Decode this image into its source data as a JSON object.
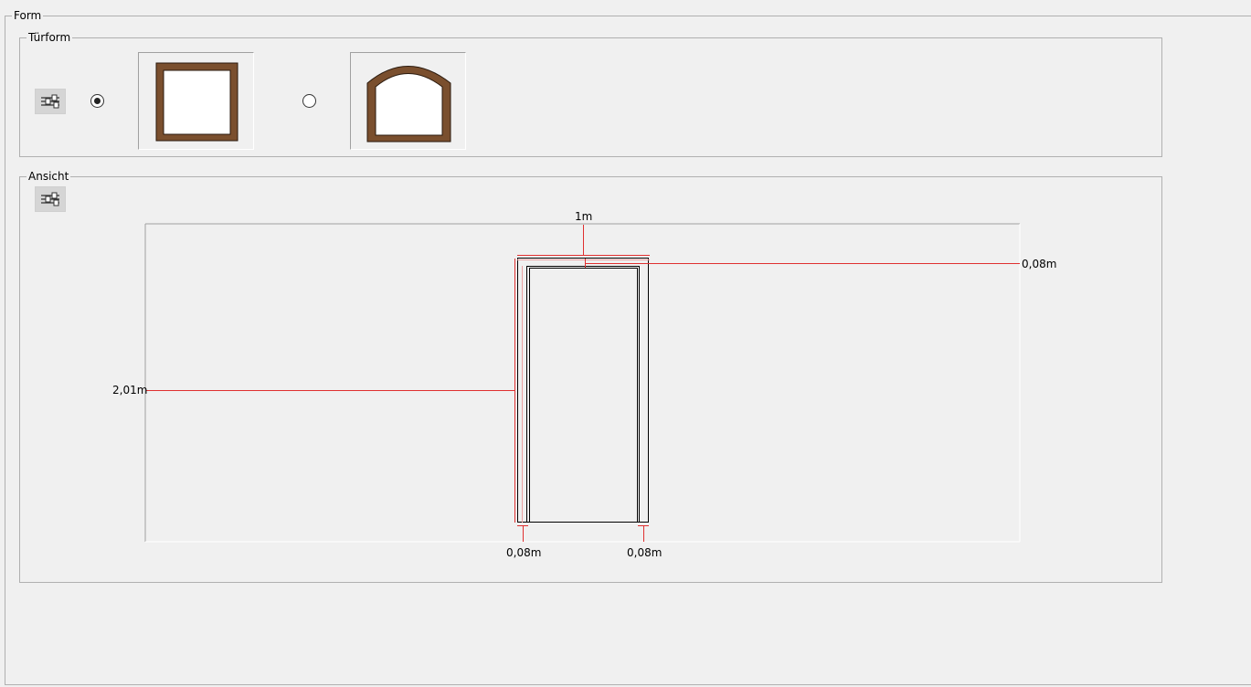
{
  "form": {
    "title": "Form"
  },
  "tuerform": {
    "title": "Türform",
    "options": [
      {
        "name": "Rechteck",
        "selected": true
      },
      {
        "name": "Rundbogen",
        "selected": false
      }
    ],
    "colors": {
      "frame": "#7a4f2e",
      "panel": "#ffffff"
    }
  },
  "ansicht": {
    "title": "Ansicht",
    "dimensions": {
      "width": "1m",
      "height": "2,01m",
      "top_frame": "0,08m",
      "left_frame": "0,08m",
      "right_frame": "0,08m"
    },
    "colors": {
      "dimension_line": "#e03030",
      "door_line": "#000000"
    }
  },
  "icons": {
    "settings": "sliders-icon"
  }
}
